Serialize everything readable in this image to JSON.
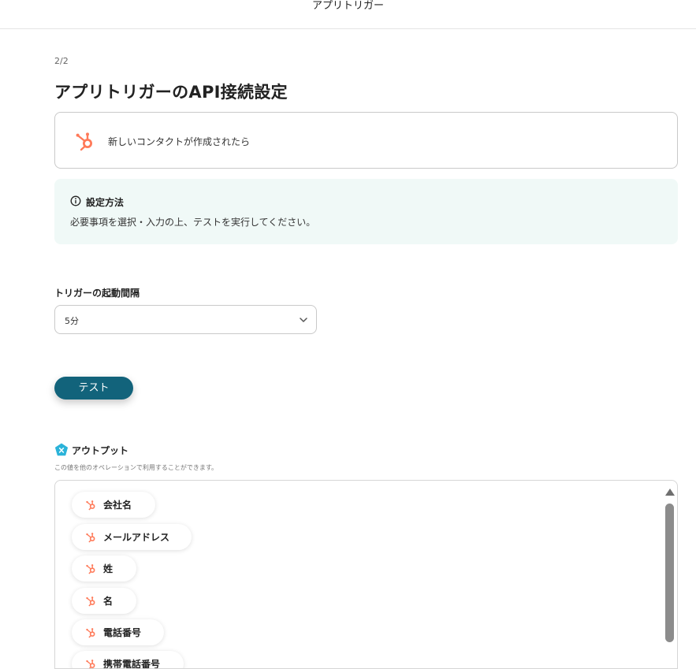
{
  "header": {
    "title": "アプリトリガー"
  },
  "step": "2/2",
  "page_title": "アプリトリガーのAPI接続設定",
  "app_card": {
    "label": "新しいコンタクトが作成されたら",
    "icon": "hubspot-logo-icon"
  },
  "info": {
    "title": "設定方法",
    "body": "必要事項を選択・入力の上、テストを実行してください。",
    "icon": "info-icon"
  },
  "interval": {
    "label": "トリガーの起動間隔",
    "value": "5分"
  },
  "test_button": {
    "label": "テスト"
  },
  "output": {
    "title": "アウトプット",
    "description": "この値を他のオペレーションで利用することができます。",
    "items": [
      {
        "label": "会社名"
      },
      {
        "label": "メールアドレス"
      },
      {
        "label": "姓"
      },
      {
        "label": "名"
      },
      {
        "label": "電話番号"
      },
      {
        "label": "携帯電話番号"
      }
    ]
  },
  "colors": {
    "accent": "#12637b",
    "hubspot": "#ff7a59",
    "info_bg": "#f0f9f7",
    "badge": "#2bb3d9"
  }
}
